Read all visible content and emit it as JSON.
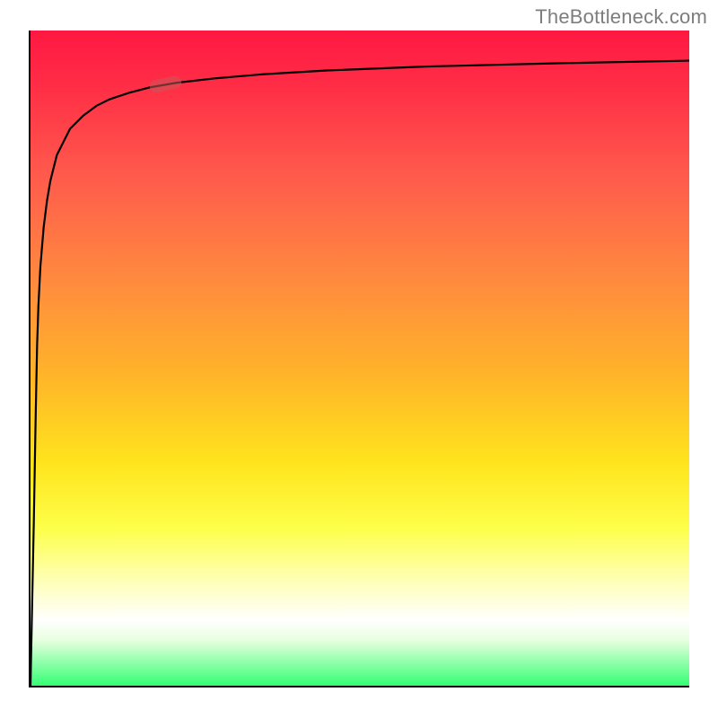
{
  "watermark": "TheBottleneck.com",
  "chart_data": {
    "type": "line",
    "title": "",
    "xlabel": "",
    "ylabel": "",
    "xlim": [
      0,
      100
    ],
    "ylim": [
      0,
      100
    ],
    "grid": false,
    "legend": false,
    "series": [
      {
        "name": "bottleneck-curve",
        "x": [
          0,
          0.5,
          0.8,
          1.0,
          1.2,
          1.5,
          2.0,
          2.5,
          3.0,
          4.0,
          5.0,
          6.0,
          8.0,
          10,
          12,
          15,
          18,
          22,
          28,
          35,
          45,
          60,
          80,
          100
        ],
        "y": [
          0,
          25,
          42,
          52,
          58,
          64,
          70,
          74,
          77,
          81,
          83,
          85,
          87,
          88.5,
          89.5,
          90.5,
          91.3,
          92.0,
          92.7,
          93.3,
          93.9,
          94.5,
          95.0,
          95.4
        ]
      }
    ],
    "marker": {
      "name": "highlight-pill",
      "x": 20.5,
      "y": 91.8,
      "angle_deg": -12
    },
    "gradient_stops": [
      {
        "pos": 0.0,
        "color": "#ff1842"
      },
      {
        "pos": 0.22,
        "color": "#ff5a4c"
      },
      {
        "pos": 0.38,
        "color": "#ff8a3f"
      },
      {
        "pos": 0.52,
        "color": "#ffb22a"
      },
      {
        "pos": 0.66,
        "color": "#ffe41d"
      },
      {
        "pos": 0.84,
        "color": "#feffb6"
      },
      {
        "pos": 0.9,
        "color": "#ffffff"
      },
      {
        "pos": 1.0,
        "color": "#34ff73"
      }
    ]
  }
}
